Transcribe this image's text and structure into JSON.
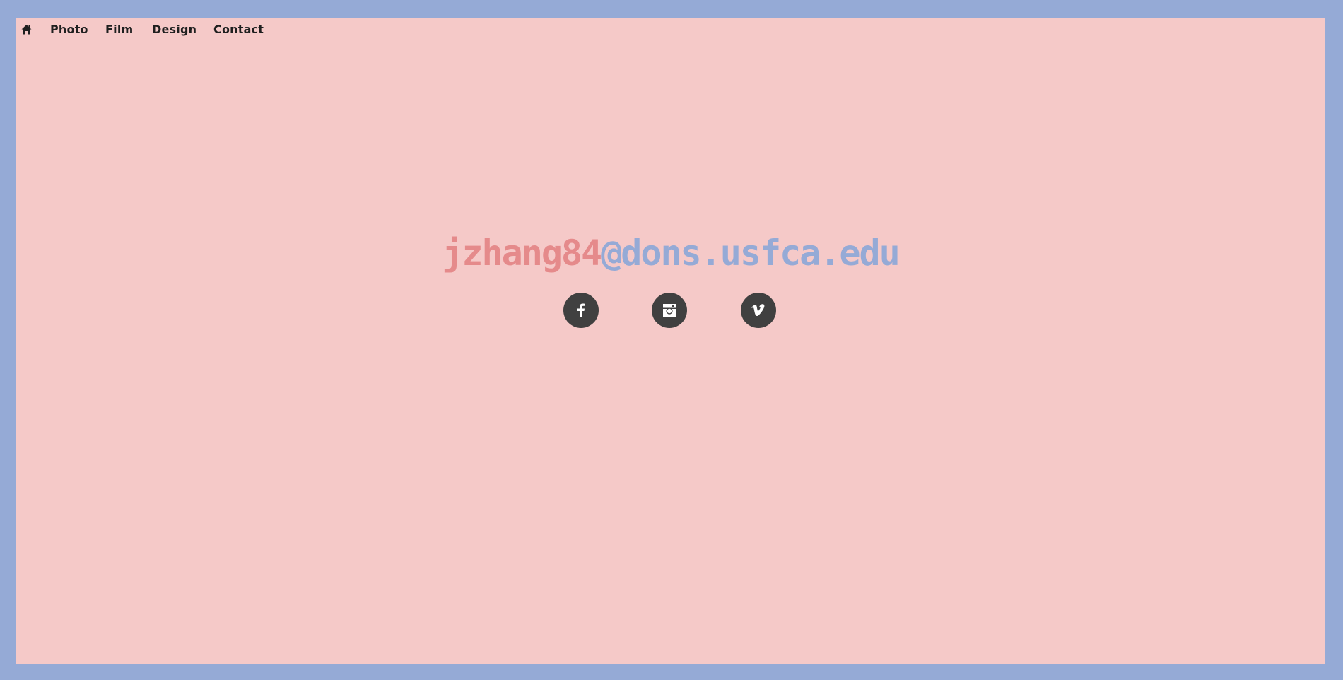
{
  "nav": {
    "home_icon": "home-icon",
    "items": [
      {
        "label": "Photo"
      },
      {
        "label": "Film"
      },
      {
        "label": "Design"
      },
      {
        "label": "Contact"
      }
    ]
  },
  "contact": {
    "email_user": "jzhang84",
    "email_domain": "@dons.usfca.edu"
  },
  "social": [
    {
      "icon": "facebook-icon"
    },
    {
      "icon": "instagram-icon"
    },
    {
      "icon": "vimeo-icon"
    }
  ],
  "colors": {
    "background": "#95aad6",
    "panel": "#f5c9c8",
    "email_user": "#e58a8b",
    "email_domain": "#95aad6",
    "social_button": "#404040",
    "nav_text": "#1f1f1f"
  }
}
